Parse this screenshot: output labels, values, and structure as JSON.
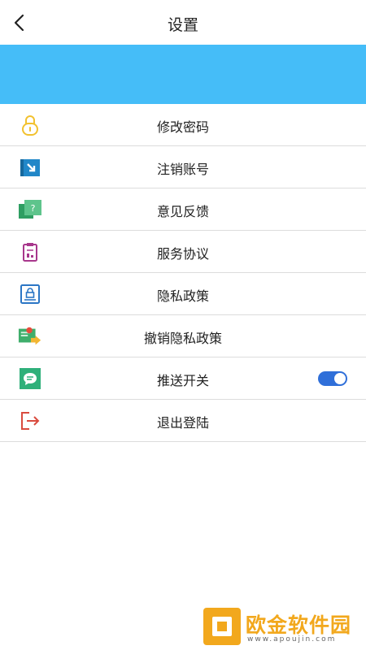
{
  "header": {
    "title": "设置"
  },
  "menu": [
    {
      "label": "修改密码",
      "icon": "lock-icon"
    },
    {
      "label": "注销账号",
      "icon": "deactivate-account-icon"
    },
    {
      "label": "意见反馈",
      "icon": "feedback-icon"
    },
    {
      "label": "服务协议",
      "icon": "clipboard-icon"
    },
    {
      "label": "隐私政策",
      "icon": "privacy-lock-icon"
    },
    {
      "label": "撤销隐私政策",
      "icon": "certificate-icon"
    },
    {
      "label": "推送开关",
      "icon": "message-icon",
      "toggle": true
    },
    {
      "label": "退出登陆",
      "icon": "logout-icon"
    }
  ],
  "watermark": {
    "text": "欧金软件园",
    "url": "www.apoujin.com"
  },
  "colors": {
    "banner": "#45bdf8",
    "toggle_on": "#2f6fd9",
    "watermark": "#f2a81d"
  }
}
